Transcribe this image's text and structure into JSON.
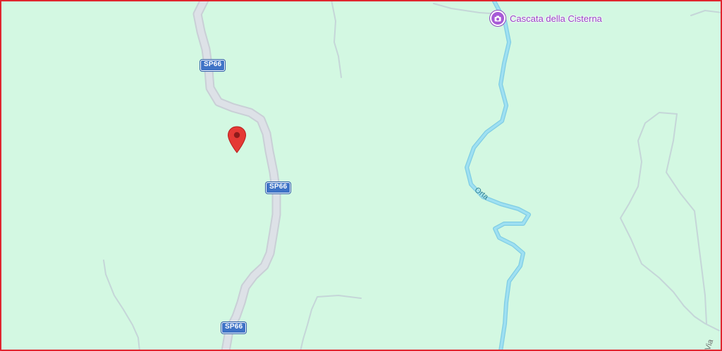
{
  "map": {
    "background_color": "#d3f8e2",
    "frame_color": "#e0262f",
    "road_shields": [
      {
        "label": "SP66"
      },
      {
        "label": "SP66"
      },
      {
        "label": "SP66"
      }
    ],
    "poi": {
      "name": "Cascata della Cisterna",
      "icon": "camera-icon",
      "color": "#a75ad6"
    },
    "river": {
      "name": "Orta",
      "color": "#8fd8ee"
    },
    "road_label_edge": "Via",
    "marker": {
      "icon": "map-pin-icon",
      "color": "#e53935"
    }
  }
}
